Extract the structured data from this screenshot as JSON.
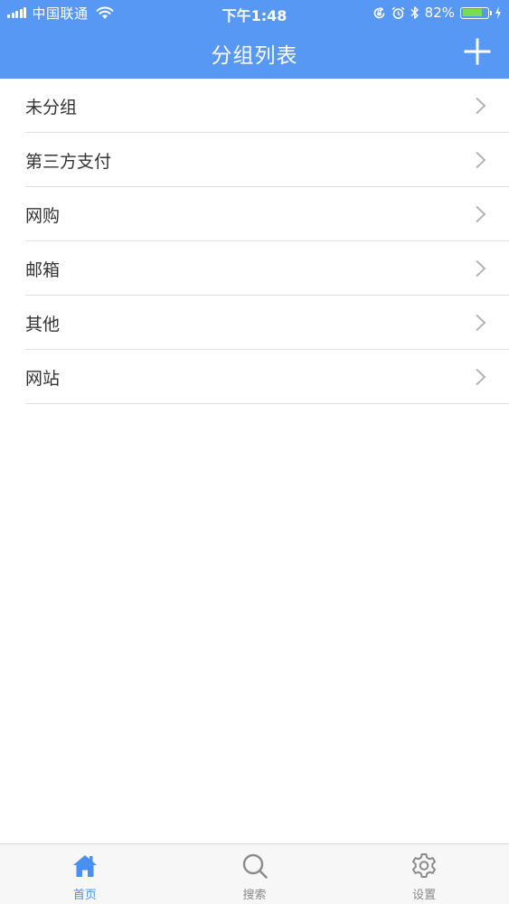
{
  "status_bar": {
    "carrier": "中国联通",
    "time": "下午1:48",
    "battery_percent": "82%",
    "battery_level": 0.82,
    "icons": [
      "signal-icon",
      "wifi-icon",
      "rotation-lock-icon",
      "alarm-icon",
      "bluetooth-icon",
      "battery-icon",
      "charging-icon"
    ]
  },
  "nav": {
    "title": "分组列表",
    "add_icon": "plus-icon"
  },
  "groups": [
    {
      "label": "未分组"
    },
    {
      "label": "第三方支付"
    },
    {
      "label": "网购"
    },
    {
      "label": "邮箱"
    },
    {
      "label": "其他"
    },
    {
      "label": "网站"
    }
  ],
  "tabs": [
    {
      "label": "首页",
      "icon": "home-icon",
      "active": true
    },
    {
      "label": "搜索",
      "icon": "search-icon",
      "active": false
    },
    {
      "label": "设置",
      "icon": "gear-icon",
      "active": false
    }
  ],
  "colors": {
    "header_bg": "#5798F4",
    "active_tab": "#4A8FF2",
    "inactive_tab": "#8A8A8A",
    "battery_fill": "#7CDB50"
  }
}
